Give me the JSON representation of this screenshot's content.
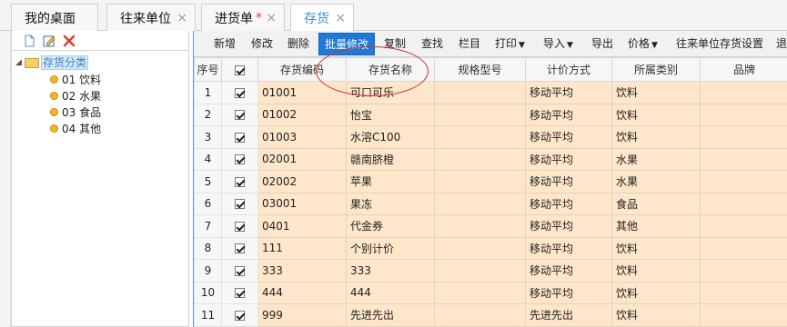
{
  "tabs": [
    {
      "label": "我的桌面",
      "closable": false
    },
    {
      "label": "往来单位",
      "closable": true
    },
    {
      "label": "进货单",
      "closable": true,
      "modified_mark": "*"
    },
    {
      "label": "存货",
      "closable": true,
      "active": true
    }
  ],
  "close_glyph": "×",
  "left_toolbar": {
    "icons": [
      "new-document-icon",
      "edit-icon",
      "delete-x-icon"
    ]
  },
  "tree": {
    "root": {
      "label": "存货分类",
      "expanded": true
    },
    "children": [
      {
        "label": "01 饮料"
      },
      {
        "label": "02 水果"
      },
      {
        "label": "03 食品"
      },
      {
        "label": "04 其他"
      }
    ]
  },
  "toolbar": {
    "buttons": [
      {
        "label": "新增"
      },
      {
        "label": "修改"
      },
      {
        "label": "删除"
      },
      {
        "label": "批量修改",
        "active": true
      },
      {
        "label": "复制"
      },
      {
        "label": "查找"
      },
      {
        "label": "栏目"
      },
      {
        "label": "打印",
        "dropdown": true
      },
      {
        "label": "导入",
        "dropdown": true
      },
      {
        "label": "导出"
      },
      {
        "label": "价格",
        "dropdown": true
      },
      {
        "label": "往来单位存货设置"
      },
      {
        "label": "退"
      }
    ],
    "caret": "▼"
  },
  "grid": {
    "headers": [
      "序号",
      "",
      "存货编码",
      "存货名称",
      "规格型号",
      "计价方式",
      "所属类别",
      "品牌"
    ],
    "rows": [
      {
        "no": "1",
        "checked": true,
        "code": "01001",
        "name": "可口可乐",
        "spec": "",
        "pricing": "移动平均",
        "category": "饮料",
        "brand": ""
      },
      {
        "no": "2",
        "checked": true,
        "code": "01002",
        "name": "怡宝",
        "spec": "",
        "pricing": "移动平均",
        "category": "饮料",
        "brand": ""
      },
      {
        "no": "3",
        "checked": true,
        "code": "01003",
        "name": "水溶C100",
        "spec": "",
        "pricing": "移动平均",
        "category": "饮料",
        "brand": ""
      },
      {
        "no": "4",
        "checked": true,
        "code": "02001",
        "name": "赣南脐橙",
        "spec": "",
        "pricing": "移动平均",
        "category": "水果",
        "brand": ""
      },
      {
        "no": "5",
        "checked": true,
        "code": "02002",
        "name": "苹果",
        "spec": "",
        "pricing": "移动平均",
        "category": "水果",
        "brand": ""
      },
      {
        "no": "6",
        "checked": true,
        "code": "03001",
        "name": "果冻",
        "spec": "",
        "pricing": "移动平均",
        "category": "食品",
        "brand": ""
      },
      {
        "no": "7",
        "checked": true,
        "code": "0401",
        "name": "代金券",
        "spec": "",
        "pricing": "移动平均",
        "category": "其他",
        "brand": ""
      },
      {
        "no": "8",
        "checked": true,
        "code": "111",
        "name": "个别计价",
        "spec": "",
        "pricing": "移动平均",
        "category": "饮料",
        "brand": ""
      },
      {
        "no": "9",
        "checked": true,
        "code": "333",
        "name": "333",
        "spec": "",
        "pricing": "移动平均",
        "category": "饮料",
        "brand": ""
      },
      {
        "no": "10",
        "checked": true,
        "code": "444",
        "name": "444",
        "spec": "",
        "pricing": "移动平均",
        "category": "饮料",
        "brand": ""
      },
      {
        "no": "11",
        "checked": true,
        "code": "999",
        "name": "先进先出",
        "spec": "",
        "pricing": "先进先出",
        "category": "饮料",
        "brand": ""
      }
    ]
  },
  "colors": {
    "accent": "#1f7ad6",
    "row_fill": "#fde6c9",
    "highlight_ellipse": "#d12f2f",
    "tab_modified_star": "#ee3333"
  }
}
